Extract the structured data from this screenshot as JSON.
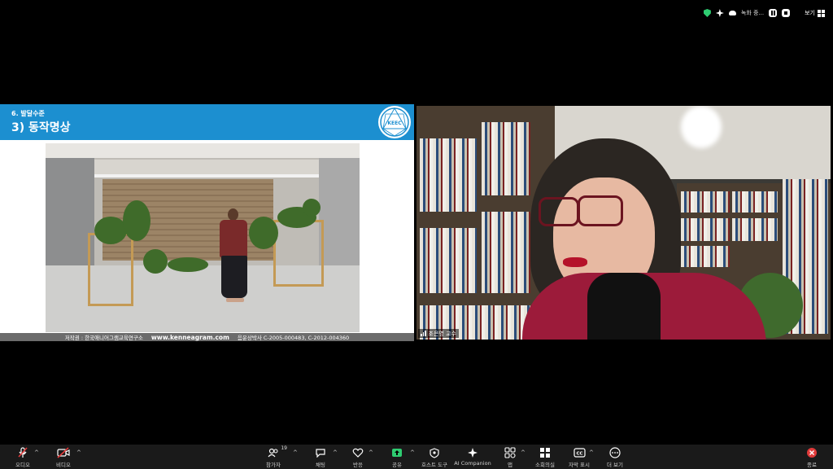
{
  "status_bar": {
    "recording_text": "녹화 중...",
    "view_label": "보기",
    "colors": {
      "shield": "#2ecc71"
    }
  },
  "slide": {
    "section": "6. 발달수준",
    "title": "3) 동작명상",
    "logo_text": "KEEC",
    "footer": {
      "copyright": "저작권 : 한국애니어그램교육연구소",
      "website": "www.kenneagram.com",
      "registration": "음운상박사 C-2005-000483, C-2012-004360"
    },
    "colors": {
      "header": "#1c8fd0"
    }
  },
  "participant": {
    "name": "조은영 교수"
  },
  "toolbar": {
    "audio": "오디오",
    "video": "비디오",
    "participants": "참가자",
    "participant_count": "19",
    "chat": "채팅",
    "reactions": "반응",
    "share": "공유",
    "host_tools": "호스트 도구",
    "ai_companion": "AI Companion",
    "apps": "앱",
    "breakout": "소회의실",
    "captions": "자막 표시",
    "more": "더 보기",
    "end": "종료",
    "colors": {
      "muted": "#e03a3a",
      "share": "#2ecc71",
      "end": "#e03a3a"
    }
  }
}
